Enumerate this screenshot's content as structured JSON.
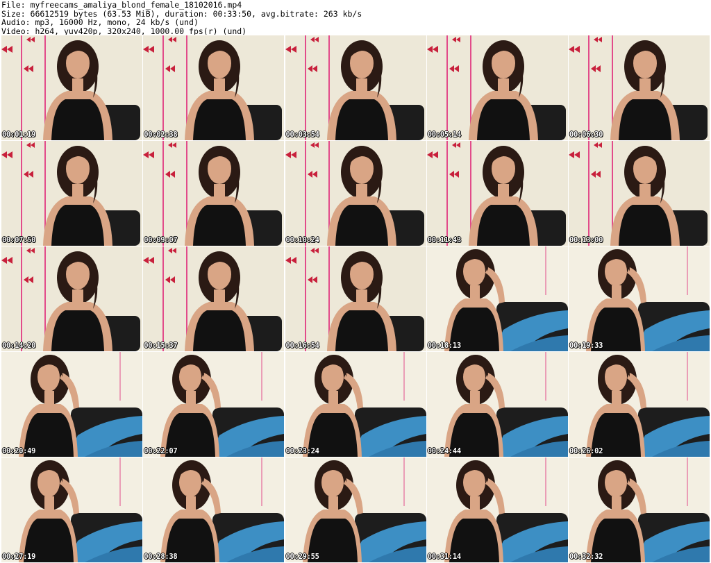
{
  "header": {
    "file_line": "File: myfreecams_amaliya_blond_female_18102016.mp4",
    "size_line": "Size: 66612519 bytes (63.53 MiB), duration: 00:33:50, avg.bitrate: 263 kb/s",
    "audio_line": "Audio: mp3, 16000 Hz, mono, 24 kb/s (und)",
    "video_line": "Video: h264, yuv420p, 320x240, 1000.00 fps(r) (und)"
  },
  "colors": {
    "wall": "#ede8d8",
    "ribbon": "#e24b8a",
    "bow": "#c8203c",
    "skin": "#d9a585",
    "hair": "#2b1a14",
    "top": "#111111",
    "jeans": "#3d8fc4"
  },
  "thumbnails": [
    {
      "time": "00:01:19",
      "scene": "seated"
    },
    {
      "time": "00:02:38",
      "scene": "seated"
    },
    {
      "time": "00:03:54",
      "scene": "seated"
    },
    {
      "time": "00:05:14",
      "scene": "seated"
    },
    {
      "time": "00:06:30",
      "scene": "seated"
    },
    {
      "time": "00:07:50",
      "scene": "seated"
    },
    {
      "time": "00:09:07",
      "scene": "seated"
    },
    {
      "time": "00:10:24",
      "scene": "seated"
    },
    {
      "time": "00:11:43",
      "scene": "seated"
    },
    {
      "time": "00:13:00",
      "scene": "seated"
    },
    {
      "time": "00:14:20",
      "scene": "seated"
    },
    {
      "time": "00:15:37",
      "scene": "seated"
    },
    {
      "time": "00:16:54",
      "scene": "seated"
    },
    {
      "time": "00:18:13",
      "scene": "reclined"
    },
    {
      "time": "00:19:33",
      "scene": "reclined"
    },
    {
      "time": "00:20:49",
      "scene": "reclined"
    },
    {
      "time": "00:22:07",
      "scene": "reclined"
    },
    {
      "time": "00:23:24",
      "scene": "reclined"
    },
    {
      "time": "00:24:44",
      "scene": "reclined"
    },
    {
      "time": "00:26:02",
      "scene": "reclined"
    },
    {
      "time": "00:27:19",
      "scene": "reclined"
    },
    {
      "time": "00:28:38",
      "scene": "reclined"
    },
    {
      "time": "00:29:55",
      "scene": "reclined"
    },
    {
      "time": "00:31:14",
      "scene": "reclined"
    },
    {
      "time": "00:32:32",
      "scene": "reclined"
    }
  ]
}
